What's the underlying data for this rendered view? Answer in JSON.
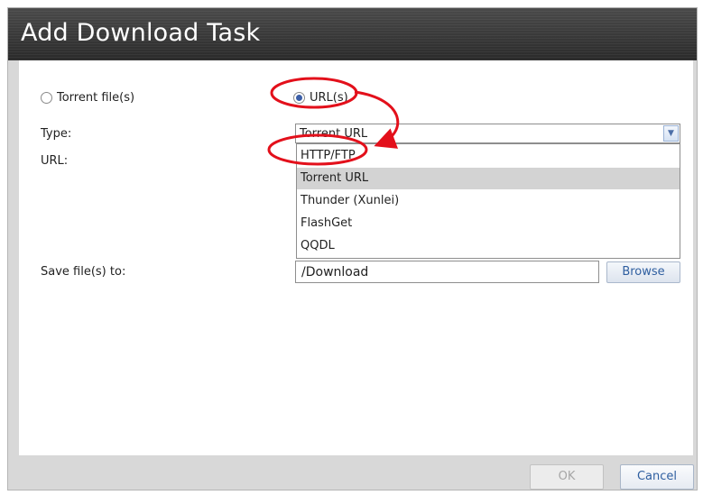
{
  "dialog": {
    "title": "Add Download Task"
  },
  "source": {
    "torrent_label": "Torrent file(s)",
    "url_label": "URL(s)",
    "selected": "url"
  },
  "form": {
    "type_label": "Type:",
    "url_label": "URL:",
    "save_label": "Save file(s) to:",
    "type_value": "Torrent URL",
    "save_path": "/Download"
  },
  "type_options": [
    "HTTP/FTP",
    "Torrent URL",
    "Thunder (Xunlei)",
    "FlashGet",
    "QQDL"
  ],
  "buttons": {
    "browse": "Browse",
    "ok": "OK",
    "cancel": "Cancel"
  },
  "annotation_color": "#e3101b"
}
